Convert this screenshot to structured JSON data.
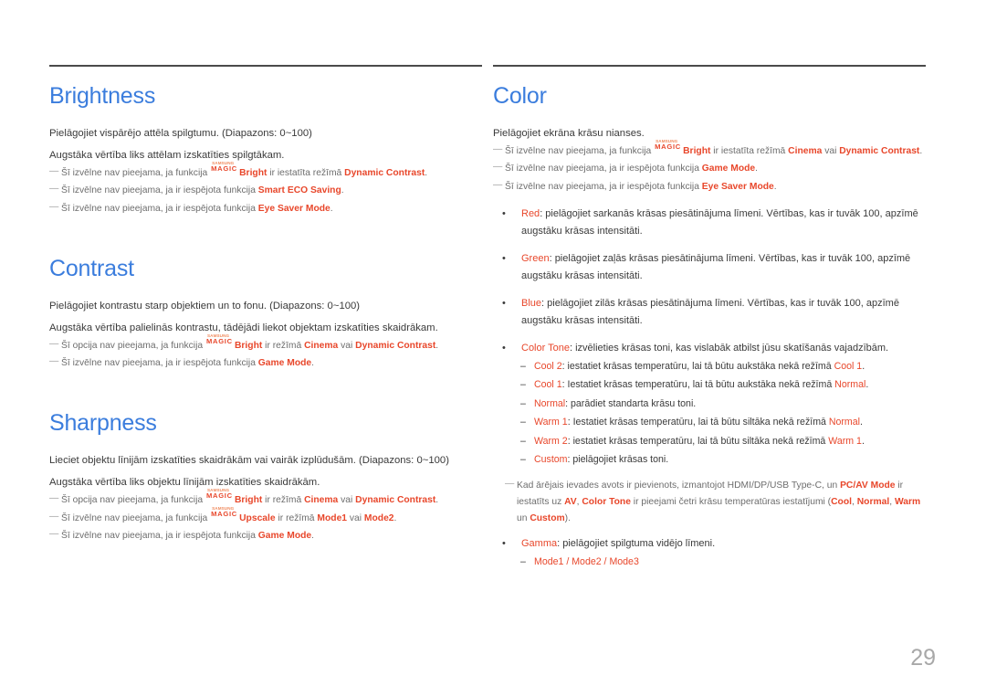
{
  "page": {
    "number": "29",
    "accent_heading_color": "#3b7ddd",
    "highlight_color": "#e8472b",
    "body_color": "#3a3a3a",
    "note_color": "#6d6d6d"
  },
  "logo": {
    "samsung": "SAMSUNG",
    "magic": "MAGIC"
  },
  "left_column": {
    "brightness": {
      "heading": "Brightness",
      "line1": "Pielāgojiet vispārējo attēla spilgtumu. (Diapazons: 0~100)",
      "line2": "Augstāka vērtība liks attēlam izskatīties spilgtākam.",
      "note1": {
        "pre": "Šī izvēlne nav pieejama, ja funkcija ",
        "logo_suffix": "Bright",
        "mid": " ir iestatīta režīmā ",
        "value1": "Dynamic Contrast",
        "post": "."
      },
      "note2": {
        "pre": "Šī izvēlne nav pieejama, ja ir iespējota funkcija ",
        "value1": "Smart ECO Saving",
        "post": "."
      },
      "note3": {
        "pre": "Šī izvēlne nav pieejama, ja ir iespējota funkcija ",
        "value1": "Eye Saver Mode",
        "post": "."
      }
    },
    "contrast": {
      "heading": "Contrast",
      "line1": "Pielāgojiet kontrastu starp objektiem un to fonu. (Diapazons: 0~100)",
      "line2": "Augstāka vērtība palielinās kontrastu, tādējādi liekot objektam izskatīties skaidrākam.",
      "note1": {
        "pre": "Šī opcija nav pieejama, ja funkcija ",
        "logo_suffix": "Bright",
        "mid": " ir režīmā ",
        "value1": "Cinema",
        "conj": " vai ",
        "value2": "Dynamic Contrast",
        "post": "."
      },
      "note2": {
        "pre": "Šī izvēlne nav pieejama, ja ir iespējota funkcija ",
        "value1": "Game Mode",
        "post": "."
      }
    },
    "sharpness": {
      "heading": "Sharpness",
      "line1": "Lieciet objektu līnijām izskatīties skaidrākām vai vairāk izplūdušām. (Diapazons: 0~100)",
      "line2": "Augstāka vērtība liks objektu līnijām izskatīties skaidrākām.",
      "note1": {
        "pre": "Šī opcija nav pieejama, ja funkcija ",
        "logo_suffix": "Bright",
        "mid": " ir režīmā ",
        "value1": "Cinema",
        "conj": " vai ",
        "value2": "Dynamic Contrast",
        "post": "."
      },
      "note2": {
        "pre": "Šī izvēlne nav pieejama, ja funkcija ",
        "logo_suffix": "Upscale",
        "mid": " ir režīmā ",
        "value1": "Mode1",
        "conj": " vai ",
        "value2": "Mode2",
        "post": "."
      },
      "note3": {
        "pre": "Šī izvēlne nav pieejama, ja ir iespējota funkcija ",
        "value1": "Game Mode",
        "post": "."
      }
    }
  },
  "right_column": {
    "color": {
      "heading": "Color",
      "line1": "Pielāgojiet ekrāna krāsu nianses.",
      "note1": {
        "pre": "Šī izvēlne nav pieejama, ja funkcija ",
        "logo_suffix": "Bright",
        "mid": " ir iestatīta režīmā ",
        "value1": "Cinema",
        "conj": " vai ",
        "value2": "Dynamic Contrast",
        "post": "."
      },
      "note2": {
        "pre": "Šī izvēlne nav pieejama, ja ir iespējota funkcija ",
        "value1": "Game Mode",
        "post": "."
      },
      "note3": {
        "pre": "Šī izvēlne nav pieejama, ja ir iespējota funkcija ",
        "value1": "Eye Saver Mode",
        "post": "."
      },
      "bullets": [
        {
          "term": "Red",
          "text": ": pielāgojiet sarkanās krāsas piesātinājuma līmeni. Vērtības, kas ir tuvāk 100, apzīmē augstāku krāsas intensitāti."
        },
        {
          "term": "Green",
          "text": ": pielāgojiet zaļās krāsas piesātinājuma līmeni. Vērtības, kas ir tuvāk 100, apzīmē augstāku krāsas intensitāti."
        },
        {
          "term": "Blue",
          "text": ": pielāgojiet zilās krāsas piesātinājuma līmeni. Vērtības, kas ir tuvāk 100, apzīmē augstāku krāsas intensitāti."
        }
      ],
      "color_tone": {
        "term": "Color Tone",
        "text": ": izvēlieties krāsas toni, kas vislabāk atbilst jūsu skatīšanās vajadzībām.",
        "items": [
          {
            "term": "Cool 2",
            "pre": ": iestatiet krāsas temperatūru, lai tā būtu aukstāka nekā režīmā ",
            "ref": "Cool 1",
            "post": "."
          },
          {
            "term": "Cool 1",
            "pre": ": Iestatiet krāsas temperatūru, lai tā būtu aukstāka nekā režīmā ",
            "ref": "Normal",
            "post": "."
          },
          {
            "term": "Normal",
            "pre": ": parādiet standarta krāsu toni.",
            "ref": "",
            "post": ""
          },
          {
            "term": "Warm 1",
            "pre": ": Iestatiet krāsas temperatūru, lai tā būtu siltāka nekā režīmā ",
            "ref": "Normal",
            "post": "."
          },
          {
            "term": "Warm 2",
            "pre": ": iestatiet krāsas temperatūru, lai tā būtu siltāka nekā režīmā ",
            "ref": "Warm 1",
            "post": "."
          },
          {
            "term": "Custom",
            "pre": ": pielāgojiet krāsas toni.",
            "ref": "",
            "post": ""
          }
        ]
      },
      "pcav_note": {
        "pre": "Kad ārējais ievades avots ir pievienots, izmantojot HDMI/DP/USB Type-C, un ",
        "value1": "PC/AV Mode",
        "mid1": " ir iestatīts uz ",
        "value2": "AV",
        "mid2": ", ",
        "value3": "Color Tone",
        "mid3": " ir pieejami četri krāsu temperatūras iestatījumi (",
        "value4": "Cool",
        "sep1": ", ",
        "value5": "Normal",
        "sep2": ", ",
        "value6": "Warm",
        "sep3": " un ",
        "value7": "Custom",
        "post": ")."
      },
      "gamma": {
        "term": "Gamma",
        "text": ": pielāgojiet spilgtuma vidējo līmeni.",
        "modes": "Mode1 / Mode2 / Mode3"
      }
    }
  }
}
